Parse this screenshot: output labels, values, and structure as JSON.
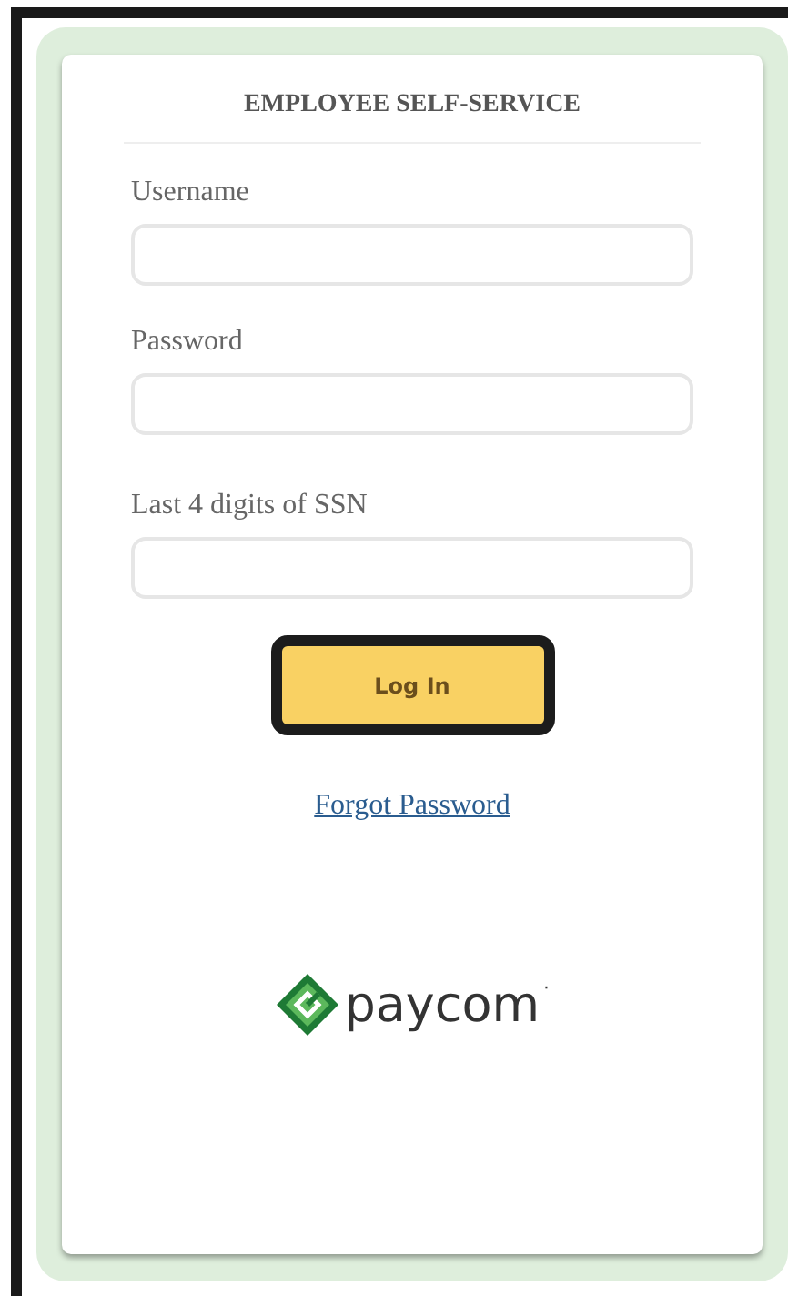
{
  "title": "EMPLOYEE SELF-SERVICE",
  "fields": [
    {
      "label": "Username"
    },
    {
      "label": "Password"
    },
    {
      "label": "Last 4 digits of SSN"
    }
  ],
  "login_button": "Log In",
  "forgot_link": "Forgot Password",
  "logo": {
    "wordmark": "paycom",
    "mark": "·"
  }
}
